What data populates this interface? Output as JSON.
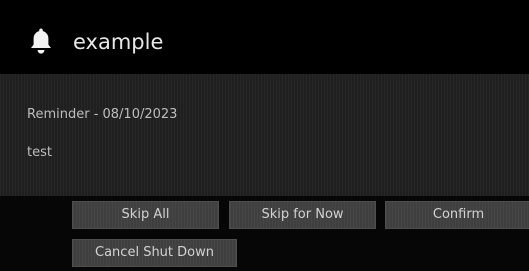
{
  "dialog": {
    "title": "example",
    "title_icon": "bell-icon"
  },
  "reminder": {
    "heading": "Reminder - 08/10/2023",
    "body": "test"
  },
  "buttons": {
    "skip_all": "Skip All",
    "skip_for_now": "Skip for Now",
    "confirm": "Confirm",
    "cancel_shut_down": "Cancel Shut Down"
  }
}
